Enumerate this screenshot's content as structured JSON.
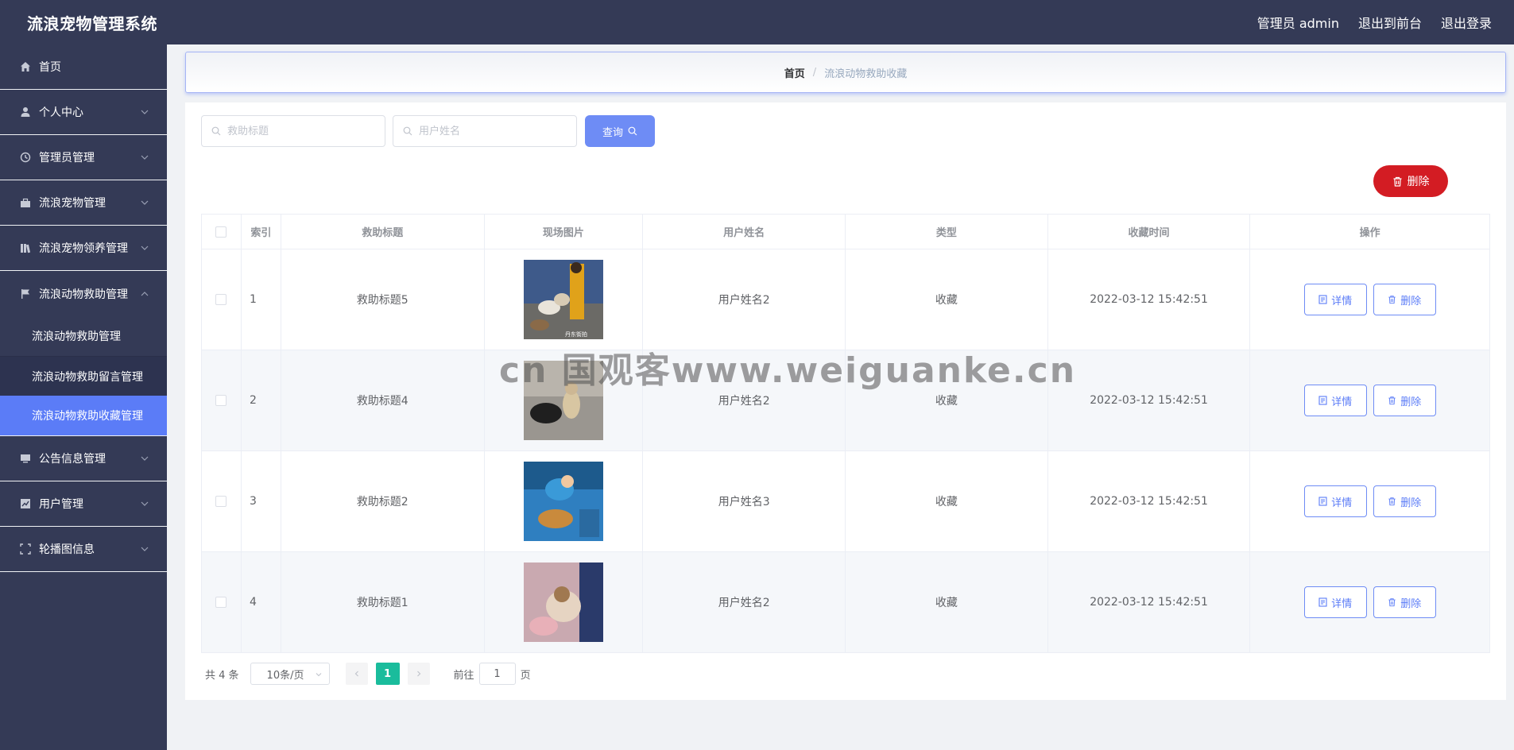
{
  "header": {
    "title": "流浪宠物管理系统",
    "user": "管理员 admin",
    "to_front": "退出到前台",
    "logout": "退出登录"
  },
  "sidebar": {
    "items": [
      {
        "label": "首页",
        "icon": "home-icon"
      },
      {
        "label": "个人中心",
        "icon": "user-icon"
      },
      {
        "label": "管理员管理",
        "icon": "clock-icon"
      },
      {
        "label": "流浪宠物管理",
        "icon": "briefcase-icon"
      },
      {
        "label": "流浪宠物领养管理",
        "icon": "books-icon"
      },
      {
        "label": "流浪动物救助管理",
        "icon": "flag-icon"
      },
      {
        "label": "公告信息管理",
        "icon": "monitor-icon"
      },
      {
        "label": "用户管理",
        "icon": "chart-icon"
      },
      {
        "label": "轮播图信息",
        "icon": "frame-icon"
      }
    ],
    "submenu": [
      {
        "label": "流浪动物救助管理"
      },
      {
        "label": "流浪动物救助留言管理"
      },
      {
        "label": "流浪动物救助收藏管理"
      }
    ]
  },
  "breadcrumb": {
    "home": "首页",
    "separator": "/",
    "current": "流浪动物救助收藏"
  },
  "search": {
    "title_placeholder": "救助标题",
    "user_placeholder": "用户姓名",
    "query_label": "查询"
  },
  "actions": {
    "delete_label": "删除"
  },
  "table": {
    "headers": [
      "索引",
      "救助标题",
      "现场图片",
      "用户姓名",
      "类型",
      "收藏时间",
      "操作"
    ],
    "rows": [
      {
        "index": "1",
        "title": "救助标题5",
        "user": "用户姓名2",
        "type": "收藏",
        "time": "2022-03-12 15:42:51",
        "image_caption": "丹东街拍"
      },
      {
        "index": "2",
        "title": "救助标题4",
        "user": "用户姓名2",
        "type": "收藏",
        "time": "2022-03-12 15:42:51"
      },
      {
        "index": "3",
        "title": "救助标题2",
        "user": "用户姓名3",
        "type": "收藏",
        "time": "2022-03-12 15:42:51"
      },
      {
        "index": "4",
        "title": "救助标题1",
        "user": "用户姓名2",
        "type": "收藏",
        "time": "2022-03-12 15:42:51"
      }
    ],
    "detail_label": "详情",
    "delete_label": "删除"
  },
  "pagination": {
    "total": "共 4 条",
    "page_size": "10条/页",
    "current_page": "1",
    "goto_prefix": "前往",
    "goto_value": "1",
    "goto_suffix": "页"
  },
  "watermark": "cn 国观客www.weiguanke.cn",
  "colors": {
    "sidebar_bg": "#343a56",
    "accent": "#5b7cf7",
    "danger": "#d31c23",
    "page_active": "#1abc9c"
  }
}
